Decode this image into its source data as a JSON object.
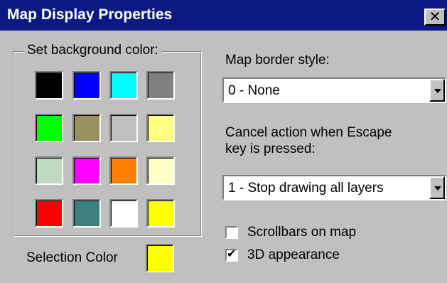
{
  "title": "Map Display Properties",
  "close_glyph": "✕",
  "background_group": {
    "legend": "Set background color:",
    "swatches": [
      {
        "name": "swatch-black",
        "color": "#000000"
      },
      {
        "name": "swatch-blue",
        "color": "#0000ff"
      },
      {
        "name": "swatch-cyan",
        "color": "#00ffff"
      },
      {
        "name": "swatch-gray",
        "color": "#808080"
      },
      {
        "name": "swatch-green",
        "color": "#00ff00"
      },
      {
        "name": "swatch-khaki",
        "color": "#998f63"
      },
      {
        "name": "swatch-light-gray",
        "color": "#c0c0c0"
      },
      {
        "name": "swatch-light-yellow",
        "color": "#ffff80"
      },
      {
        "name": "swatch-pale-green",
        "color": "#c0dcc0"
      },
      {
        "name": "swatch-magenta",
        "color": "#ff00ff"
      },
      {
        "name": "swatch-orange",
        "color": "#ff8000"
      },
      {
        "name": "swatch-cream",
        "color": "#ffffc8"
      },
      {
        "name": "swatch-red",
        "color": "#ff0000"
      },
      {
        "name": "swatch-teal",
        "color": "#3c7f7f"
      },
      {
        "name": "swatch-white",
        "color": "#ffffff"
      },
      {
        "name": "swatch-yellow",
        "color": "#ffff00"
      }
    ]
  },
  "selection_color": {
    "label": "Selection Color",
    "color": "#ffff00"
  },
  "border_style": {
    "label": "Map border style:",
    "value": "0 - None"
  },
  "cancel_action": {
    "label_line1": "Cancel action when Escape",
    "label_line2": "key is pressed:",
    "value": "1 - Stop drawing all layers"
  },
  "options": {
    "scrollbars": {
      "label": "Scrollbars on map",
      "checked": false
    },
    "appearance_3d": {
      "label": "3D appearance",
      "checked": true
    }
  },
  "check_glyph": "✔"
}
